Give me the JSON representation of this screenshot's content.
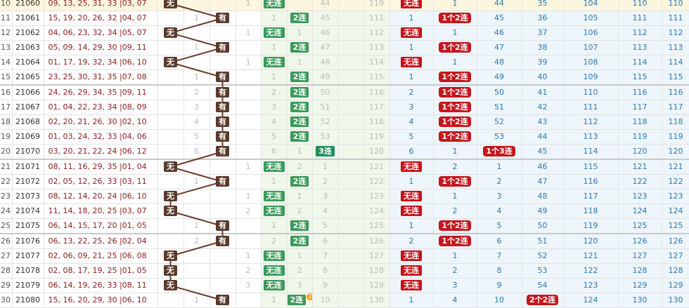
{
  "labels": {
    "none": "无",
    "has": "有",
    "nolink": "无连",
    "two": "2连",
    "three": "3连",
    "one2": "1个2连",
    "one3": "1个3连",
    "two2": "2个2连"
  },
  "colors": {
    "line": "#6b3a2a",
    "dark_badge": "#5a3a2a",
    "green_badge": "#3a9a5a",
    "red_badge": "#c8101a"
  },
  "rows": [
    {
      "idx": "10",
      "period": "21060",
      "nums": "09, 13, 25, 31, 33",
      "last": "03, 07",
      "s": "无",
      "ca": "",
      "cb": "1",
      "g1": "无连",
      "g2": "",
      "g3": "44",
      "g4": "110",
      "r1": "无连",
      "r2": "1",
      "r3": "44",
      "r4": "35",
      "r5": "104",
      "r6": "110"
    },
    {
      "idx": "11",
      "period": "21061",
      "nums": "15, 19, 20, 26, 32",
      "last": "04, 07",
      "s": "有",
      "ca": "1",
      "cb": "",
      "g1": "1",
      "g2": "2连",
      "g3": "45",
      "g4": "111",
      "r1": "1",
      "r2": "1个2连",
      "r3": "45",
      "r4": "36",
      "r5": "105",
      "r6": "111"
    },
    {
      "idx": "12",
      "period": "21062",
      "nums": "04, 06, 23, 32, 34",
      "last": "05, 07",
      "s": "无",
      "ca": "",
      "cb": "1",
      "g1": "无连",
      "g2": "1",
      "g3": "46",
      "g4": "112",
      "r1": "无连",
      "r2": "1",
      "r3": "46",
      "r4": "37",
      "r5": "106",
      "r6": "112"
    },
    {
      "idx": "13",
      "period": "21063",
      "nums": "05, 09, 14, 29, 30",
      "last": "09, 11",
      "s": "有",
      "ca": "1",
      "cb": "",
      "g1": "1",
      "g2": "2连",
      "g3": "47",
      "g4": "113",
      "r1": "1",
      "r2": "1个2连",
      "r3": "47",
      "r4": "38",
      "r5": "107",
      "r6": "113"
    },
    {
      "idx": "14",
      "period": "21064",
      "nums": "01, 17, 19, 32, 34",
      "last": "06, 10",
      "s": "无",
      "ca": "",
      "cb": "1",
      "g1": "无连",
      "g2": "1",
      "g3": "48",
      "g4": "114",
      "r1": "无连",
      "r2": "1",
      "r3": "48",
      "r4": "39",
      "r5": "108",
      "r6": "114"
    },
    {
      "idx": "15",
      "period": "21065",
      "nums": "23, 25, 30, 31, 35",
      "last": "07, 08",
      "s": "有",
      "ca": "1",
      "cb": "",
      "g1": "1",
      "g2": "2连",
      "g3": "49",
      "g4": "115",
      "r1": "1",
      "r2": "1个2连",
      "r3": "49",
      "r4": "40",
      "r5": "109",
      "r6": "115",
      "sep": true
    },
    {
      "idx": "16",
      "period": "21066",
      "nums": "24, 26, 29, 34, 35",
      "last": "09, 11",
      "s": "有",
      "ca": "2",
      "cb": "",
      "g1": "2",
      "g2": "2连",
      "g3": "50",
      "g4": "116",
      "r1": "2",
      "r2": "1个2连",
      "r3": "50",
      "r4": "41",
      "r5": "110",
      "r6": "116"
    },
    {
      "idx": "17",
      "period": "21067",
      "nums": "01, 04, 22, 23, 34",
      "last": "08, 09",
      "s": "有",
      "ca": "3",
      "cb": "",
      "g1": "3",
      "g2": "2连",
      "g3": "51",
      "g4": "117",
      "r1": "3",
      "r2": "1个2连",
      "r3": "51",
      "r4": "42",
      "r5": "111",
      "r6": "117"
    },
    {
      "idx": "18",
      "period": "21068",
      "nums": "02, 20, 21, 26, 30",
      "last": "02, 10",
      "s": "有",
      "ca": "4",
      "cb": "",
      "g1": "4",
      "g2": "2连",
      "g3": "52",
      "g4": "118",
      "r1": "4",
      "r2": "1个2连",
      "r3": "52",
      "r4": "43",
      "r5": "112",
      "r6": "118"
    },
    {
      "idx": "19",
      "period": "21069",
      "nums": "01, 03, 24, 32, 33",
      "last": "04, 06",
      "s": "有",
      "ca": "5",
      "cb": "",
      "g1": "5",
      "g2": "2连",
      "g3": "53",
      "g4": "119",
      "r1": "5",
      "r2": "1个2连",
      "r3": "53",
      "r4": "44",
      "r5": "113",
      "r6": "119"
    },
    {
      "idx": "20",
      "period": "21070",
      "nums": "03, 20, 21, 22, 24",
      "last": "06, 12",
      "s": "有",
      "ca": "6",
      "cb": "",
      "g1": "6",
      "g2": "1",
      "g3": "3连",
      "g4": "120",
      "r1": "6",
      "r2": "1",
      "r3": "1个3连",
      "r4": "45",
      "r5": "114",
      "r6": "120",
      "sep": true
    },
    {
      "idx": "21",
      "period": "21071",
      "nums": "08, 11, 16, 29, 35",
      "last": "01, 04",
      "s": "无",
      "ca": "",
      "cb": "1",
      "g1": "无连",
      "g2": "2",
      "g3": "1",
      "g4": "121",
      "r1": "无连",
      "r2": "2",
      "r3": "1",
      "r4": "46",
      "r5": "115",
      "r6": "121"
    },
    {
      "idx": "22",
      "period": "21072",
      "nums": "02, 05, 12, 26, 33",
      "last": "03, 11",
      "s": "有",
      "ca": "1",
      "cb": "",
      "g1": "1",
      "g2": "2连",
      "g3": "2",
      "g4": "122",
      "r1": "1",
      "r2": "1个2连",
      "r3": "2",
      "r4": "47",
      "r5": "116",
      "r6": "122"
    },
    {
      "idx": "23",
      "period": "21073",
      "nums": "08, 12, 14, 20, 24",
      "last": "06, 10",
      "s": "无",
      "ca": "",
      "cb": "1",
      "g1": "无连",
      "g2": "1",
      "g3": "3",
      "g4": "123",
      "r1": "无连",
      "r2": "1",
      "r3": "3",
      "r4": "48",
      "r5": "117",
      "r6": "123"
    },
    {
      "idx": "24",
      "period": "21074",
      "nums": "11, 14, 18, 20, 25",
      "last": "03, 07",
      "s": "无",
      "ca": "",
      "cb": "2",
      "g1": "无连",
      "g2": "2",
      "g3": "4",
      "g4": "124",
      "r1": "无连",
      "r2": "2",
      "r3": "4",
      "r4": "49",
      "r5": "118",
      "r6": "124"
    },
    {
      "idx": "25",
      "period": "21075",
      "nums": "06, 14, 15, 17, 20",
      "last": "01, 05",
      "s": "有",
      "ca": "1",
      "cb": "",
      "g1": "1",
      "g2": "2连",
      "g3": "5",
      "g4": "125",
      "r1": "1",
      "r2": "1个2连",
      "r3": "5",
      "r4": "50",
      "r5": "119",
      "r6": "125",
      "sep": true
    },
    {
      "idx": "26",
      "period": "21076",
      "nums": "06, 13, 22, 25, 26",
      "last": "02, 04",
      "s": "有",
      "ca": "2",
      "cb": "",
      "g1": "2",
      "g2": "2连",
      "g3": "6",
      "g4": "126",
      "r1": "2",
      "r2": "1个2连",
      "r3": "6",
      "r4": "51",
      "r5": "120",
      "r6": "126"
    },
    {
      "idx": "27",
      "period": "21077",
      "nums": "02, 06, 09, 21, 25",
      "last": "06, 08",
      "s": "无",
      "ca": "",
      "cb": "1",
      "g1": "无连",
      "g2": "1",
      "g3": "7",
      "g4": "127",
      "r1": "无连",
      "r2": "1",
      "r3": "7",
      "r4": "52",
      "r5": "121",
      "r6": "127"
    },
    {
      "idx": "28",
      "period": "21078",
      "nums": "02, 08, 17, 19, 25",
      "last": "01, 05",
      "s": "无",
      "ca": "",
      "cb": "2",
      "g1": "无连",
      "g2": "2",
      "g3": "8",
      "g4": "128",
      "r1": "无连",
      "r2": "2",
      "r3": "8",
      "r4": "53",
      "r5": "122",
      "r6": "128"
    },
    {
      "idx": "29",
      "period": "21079",
      "nums": "06, 14, 19, 26, 33",
      "last": "08, 11",
      "s": "无",
      "ca": "",
      "cb": "3",
      "g1": "无连",
      "g2": "3",
      "g3": "9",
      "g4": "129",
      "r1": "无连",
      "r2": "3",
      "r3": "9",
      "r4": "54",
      "r5": "123",
      "r6": "129"
    },
    {
      "idx": "30",
      "period": "21080",
      "nums": "15, 16, 20, 29, 30",
      "last": "06, 10",
      "s": "有",
      "ca": "1",
      "cb": "",
      "g1": "1",
      "g2": "2连",
      "g2dot": "2",
      "g3": "10",
      "g4": "130",
      "r1": "1",
      "r2": "4",
      "r3": "10",
      "r4": "2个2连",
      "r5": "124",
      "r6": "130"
    }
  ]
}
